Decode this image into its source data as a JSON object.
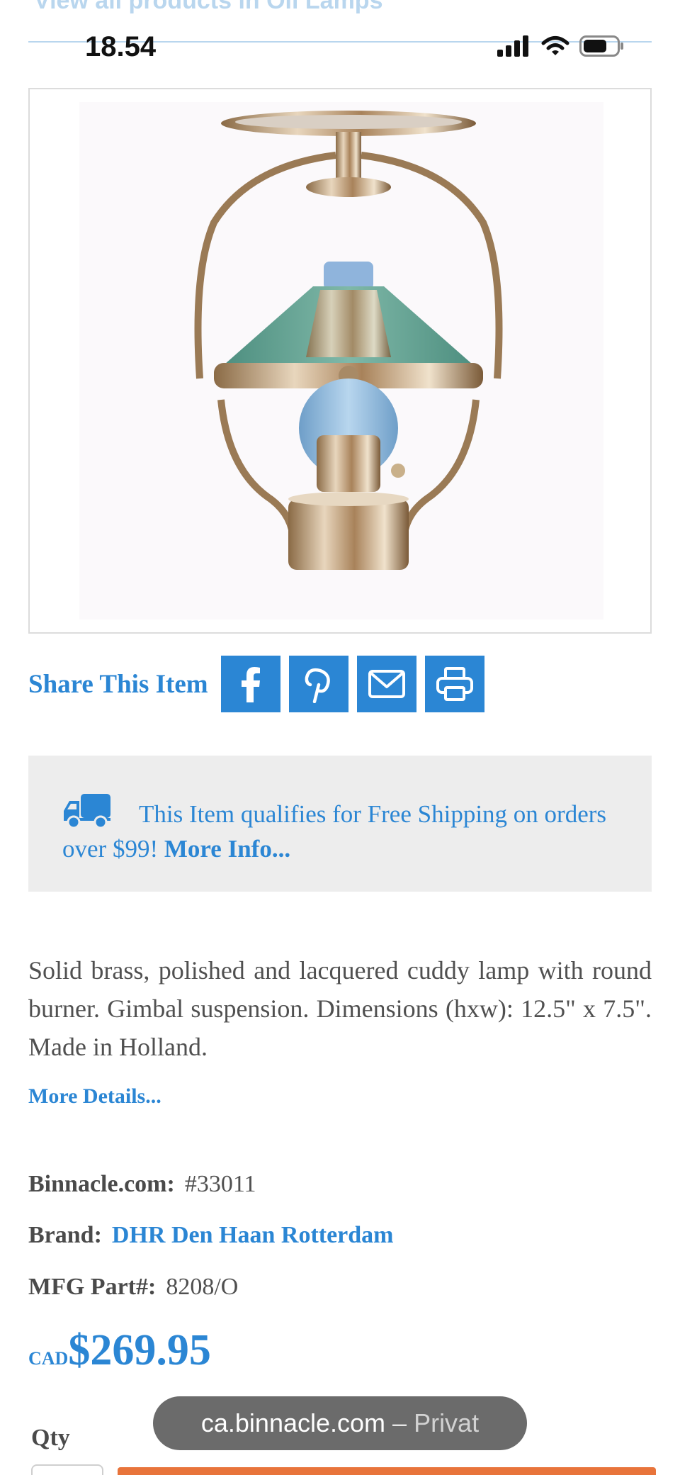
{
  "top": {
    "faded_link": "View all products in Oil Lamps"
  },
  "status_bar": {
    "time": "18.54"
  },
  "share": {
    "label": "Share This Item",
    "buttons": [
      "facebook-icon",
      "pinterest-icon",
      "mail-icon",
      "print-icon"
    ]
  },
  "shipping": {
    "text": "This Item qualifies for Free Shipping on orders over $99!",
    "more_link": "More Info..."
  },
  "product": {
    "description": "Solid brass, polished and lacquered cuddy lamp with round burner. Gimbal suspension. Dimensions (hxw): 12.5\" x 7.5\". Made in Holland.",
    "more_details": "More Details...",
    "specs": {
      "sku_label": "Binnacle.com:",
      "sku_value": "#33011",
      "brand_label": "Brand:",
      "brand_value": "DHR Den Haan Rotterdam",
      "mfg_label": "MFG Part#:",
      "mfg_value": "8208/O"
    },
    "price_currency": "CAD",
    "price_amount": "$269.95",
    "qty_label": "Qty"
  },
  "browser": {
    "domain": "ca.binnacle.com",
    "separator": "–",
    "mode": "Privat"
  },
  "colors": {
    "accent": "#2b86d4",
    "shipping_bg": "#ededed",
    "cart_button": "#e8743b"
  }
}
